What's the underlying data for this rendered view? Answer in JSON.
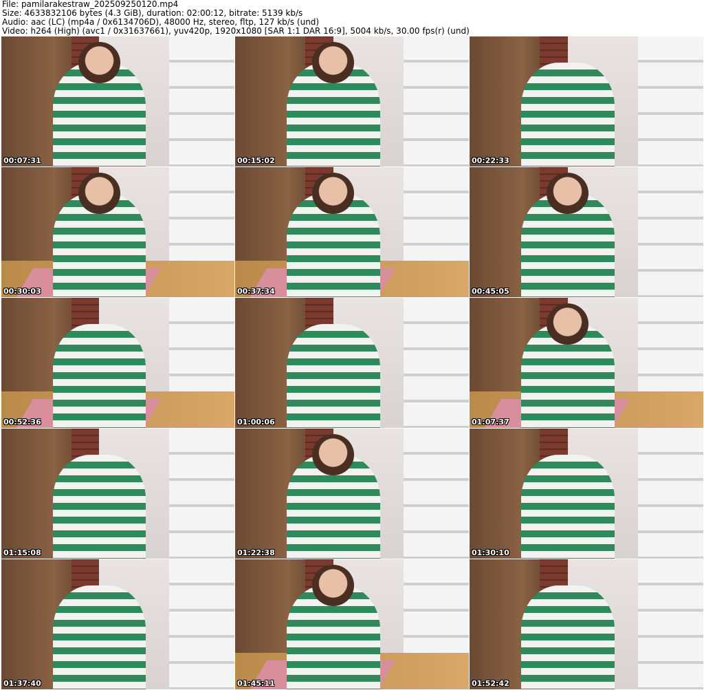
{
  "header": {
    "file": "File: pamilarakestraw_202509250120.mp4",
    "size": "Size: 4633832106 bytes (4.3 GiB), duration: 02:00:12, bitrate: 5139 kb/s",
    "audio": "Audio: aac (LC) (mp4a / 0x6134706D), 48000 Hz, stereo, fltp, 127 kb/s (und)",
    "video": "Video: h264 (High) (avc1 / 0x31637661), yuv420p, 1920x1080 [SAR 1:1 DAR 16:9], 5004 kb/s, 30.00 fps(r) (und)"
  },
  "thumbnails": [
    {
      "timestamp": "00:07:31"
    },
    {
      "timestamp": "00:15:02"
    },
    {
      "timestamp": "00:22:33"
    },
    {
      "timestamp": "00:30:03"
    },
    {
      "timestamp": "00:37:34"
    },
    {
      "timestamp": "00:45:05"
    },
    {
      "timestamp": "00:52:36"
    },
    {
      "timestamp": "01:00:06"
    },
    {
      "timestamp": "01:07:37"
    },
    {
      "timestamp": "01:15:08"
    },
    {
      "timestamp": "01:22:38"
    },
    {
      "timestamp": "01:30:10"
    },
    {
      "timestamp": "01:37:40"
    },
    {
      "timestamp": "01:45:11"
    },
    {
      "timestamp": "01:52:42"
    }
  ]
}
